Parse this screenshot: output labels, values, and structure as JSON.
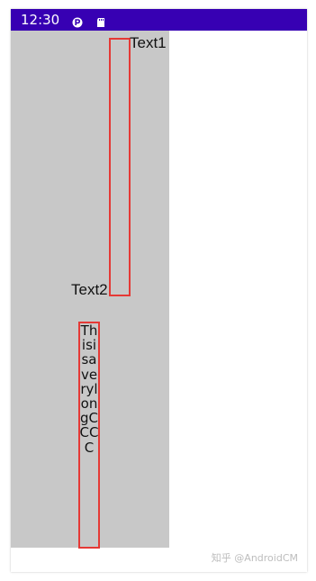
{
  "status_bar": {
    "time": "12:30",
    "icons": [
      "notification-p-icon",
      "sd-card-icon"
    ]
  },
  "text1": "Text1",
  "text2": "Text2",
  "long_text": "ThisisaverylongCCCC",
  "watermark": "知乎 @AndroidCM",
  "colors": {
    "status_bar": "#3700b3",
    "panel": "#c8c8c8",
    "border": "#e53935"
  }
}
